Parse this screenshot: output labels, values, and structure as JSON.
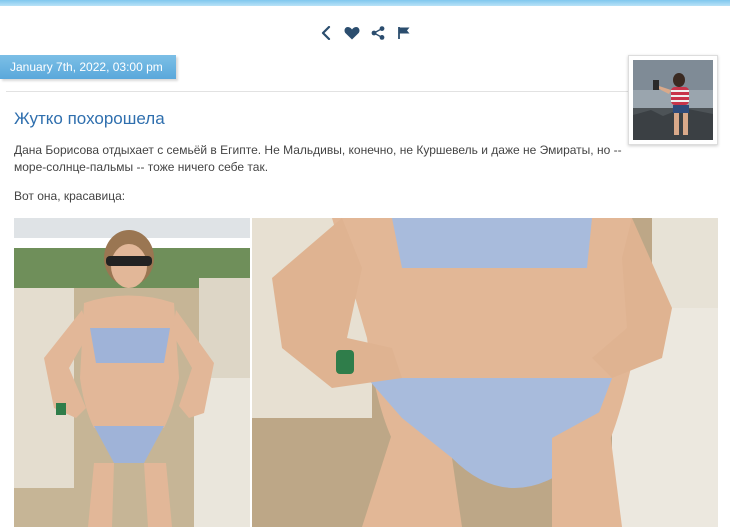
{
  "toolbar": {
    "icons": [
      "back-icon",
      "heart-icon",
      "share-icon",
      "flag-icon"
    ]
  },
  "post": {
    "date": "January 7th, 2022, 03:00 pm",
    "title": "Жутко похорошела",
    "text": "Дана Борисова отдыхает с семьёй в Египте. Не Мальдивы, конечно, не Куршевель и даже не Эмираты, но -- море-солнце-пальмы -- тоже ничего себе так.",
    "text2": "Вот она, красавица:"
  },
  "colors": {
    "accent": "#5aa8db",
    "title": "#2f6fae",
    "icon": "#2b4d6e"
  }
}
